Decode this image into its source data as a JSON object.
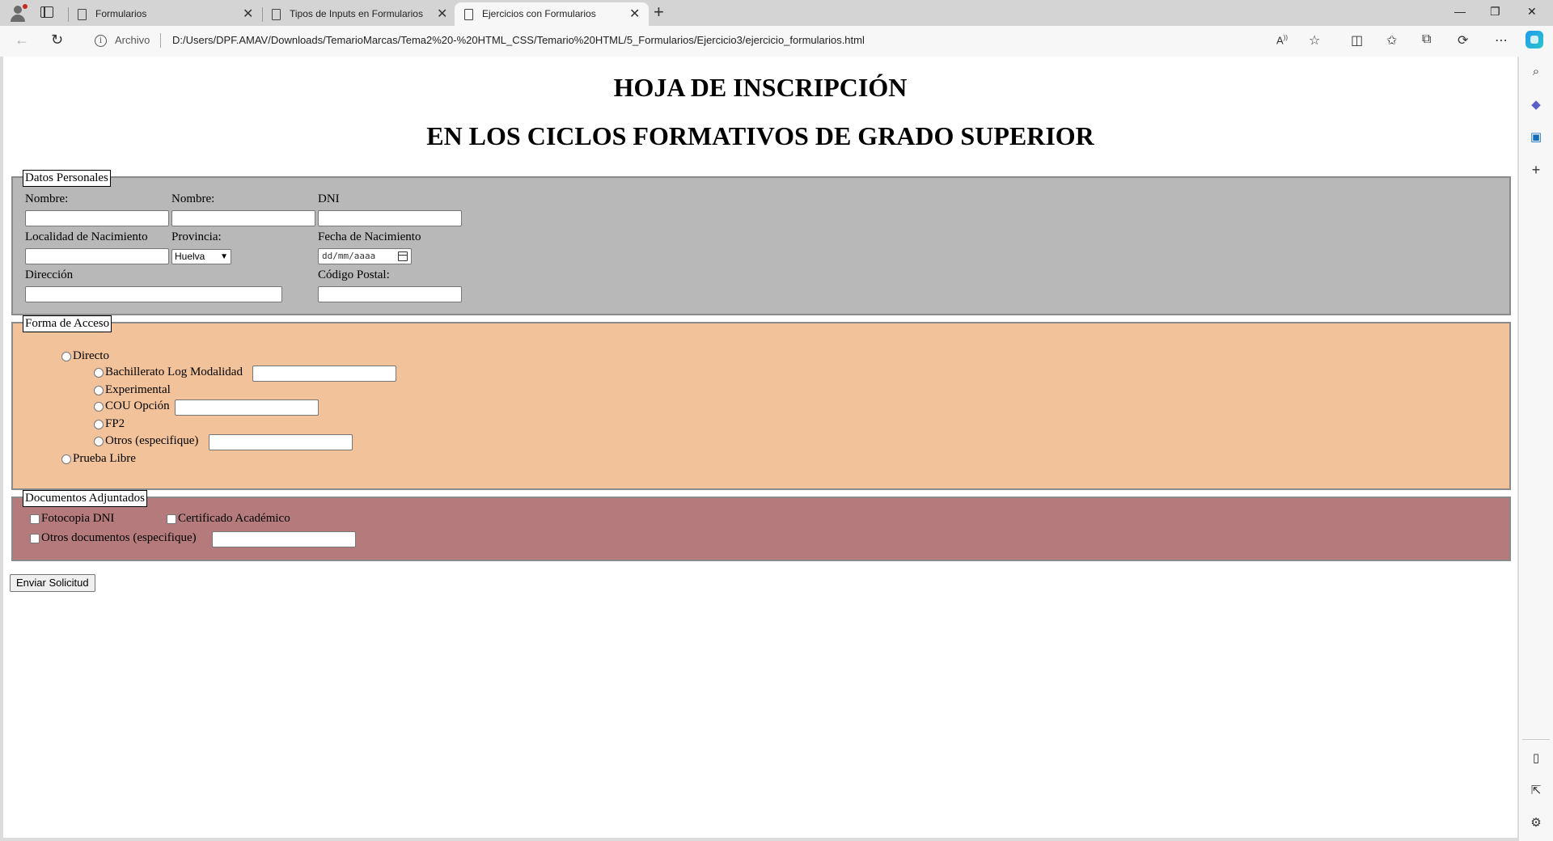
{
  "browser": {
    "tabs": [
      {
        "title": "Formularios"
      },
      {
        "title": "Tipos de Inputs en Formularios"
      },
      {
        "title": "Ejercicios con Formularios"
      }
    ],
    "address": {
      "scheme_label": "Archivo",
      "url": "D:/Users/DPF.AMAV/Downloads/TemarioMarcas/Tema2%20-%20HTML_CSS/Temario%20HTML/5_Formularios/Ejercicio3/ejercicio_formularios.html"
    }
  },
  "page": {
    "heading1": "HOJA DE INSCRIPCIÓN",
    "heading2": "EN LOS CICLOS FORMATIVOS DE GRADO SUPERIOR",
    "datos": {
      "legend": "Datos Personales",
      "nombre1_label": "Nombre:",
      "nombre2_label": "Nombre:",
      "dni_label": "DNI",
      "localidad_label": "Localidad de Nacimiento",
      "provincia_label": "Provincia:",
      "provincia_value": "Huelva",
      "fecha_label": "Fecha de Nacimiento",
      "fecha_placeholder": "dd/mm/aaaa",
      "direccion_label": "Dirección",
      "cp_label": "Código Postal:"
    },
    "acceso": {
      "legend": "Forma de Acceso",
      "directo": "Directo",
      "bachillerato": "Bachillerato Log Modalidad",
      "experimental": "Experimental",
      "cou": "COU Opción",
      "fp2": "FP2",
      "otros": "Otros (especifique)",
      "prueba": "Prueba Libre"
    },
    "documentos": {
      "legend": "Documentos Adjuntados",
      "fotocopia": "Fotocopia DNI",
      "certificado": "Certificado Académico",
      "otros": "Otros documentos (especifique)"
    },
    "submit_label": "Enviar Solicitud"
  },
  "colors": {
    "datos_bg": "#b8b8b8",
    "acceso_bg": "#f2c29b",
    "documentos_bg": "#b57b7c"
  }
}
